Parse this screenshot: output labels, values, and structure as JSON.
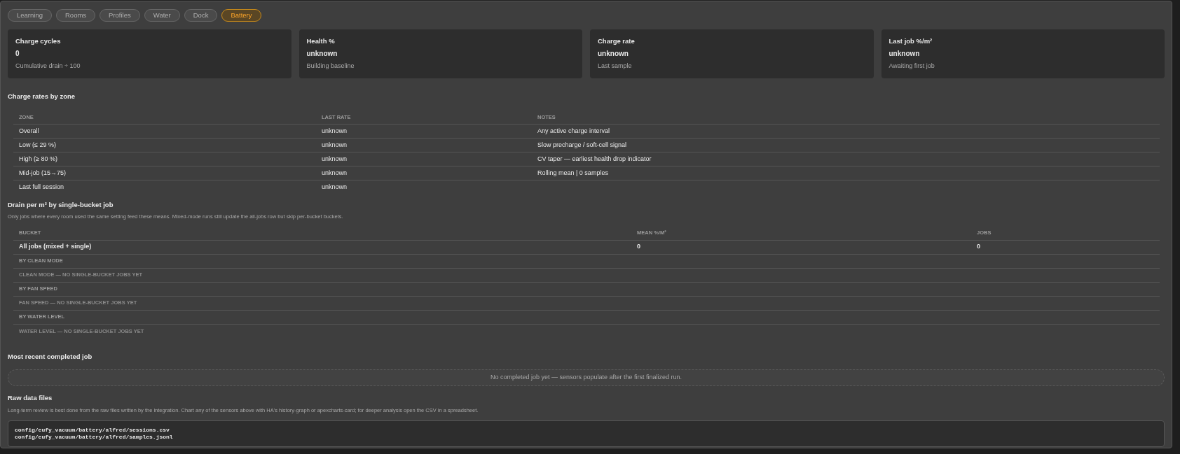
{
  "tabs": [
    {
      "label": "Learning",
      "selected": false
    },
    {
      "label": "Rooms",
      "selected": false
    },
    {
      "label": "Profiles",
      "selected": false
    },
    {
      "label": "Water",
      "selected": false
    },
    {
      "label": "Dock",
      "selected": false
    },
    {
      "label": "Battery",
      "selected": true
    }
  ],
  "stats": [
    {
      "title": "Charge cycles",
      "value": "0",
      "caption": "Cumulative drain ÷ 100"
    },
    {
      "title": "Health %",
      "value": "unknown",
      "caption": "Building baseline"
    },
    {
      "title": "Charge rate",
      "value": "unknown",
      "caption": "Last sample"
    },
    {
      "title": "Last job %/m²",
      "value": "unknown",
      "caption": "Awaiting first job"
    }
  ],
  "zone_table": {
    "title": "Charge rates by zone",
    "columns": [
      "ZONE",
      "LAST RATE",
      "NOTES"
    ],
    "rows": [
      [
        "Overall",
        "unknown",
        "Any active charge interval"
      ],
      [
        "Low (≤ 29 %)",
        "unknown",
        "Slow precharge / soft-cell signal"
      ],
      [
        "High (≥ 80 %)",
        "unknown",
        "CV taper — earliest health drop indicator"
      ],
      [
        "Mid-job (15→75)",
        "unknown",
        "Rolling mean | 0 samples"
      ],
      [
        "Last full session",
        "unknown"
      ]
    ]
  },
  "drain_table": {
    "title": "Drain per m² by single-bucket job",
    "description": "Only jobs where every room used the same setting feed these means. Mixed-mode runs still update the all-jobs row but skip per-bucket buckets.",
    "columns": [
      "BUCKET",
      "MEAN %/M²",
      "JOBS"
    ],
    "rows": [
      {
        "kind": "data",
        "cells": [
          "All jobs (mixed + single)",
          "0",
          "0"
        ]
      },
      {
        "kind": "group",
        "cells": [
          "BY CLEAN MODE"
        ]
      },
      {
        "kind": "empty",
        "cells": [
          "CLEAN MODE — NO SINGLE-BUCKET JOBS YET"
        ]
      },
      {
        "kind": "group",
        "cells": [
          "BY FAN SPEED"
        ]
      },
      {
        "kind": "empty",
        "cells": [
          "FAN SPEED — NO SINGLE-BUCKET JOBS YET"
        ]
      },
      {
        "kind": "group",
        "cells": [
          "BY WATER LEVEL"
        ]
      },
      {
        "kind": "empty",
        "cells": [
          "WATER LEVEL — NO SINGLE-BUCKET JOBS YET"
        ]
      }
    ]
  },
  "recent_job": {
    "title": "Most recent completed job",
    "empty_message": "No completed job yet — sensors populate after the first finalized run."
  },
  "raw_files": {
    "title": "Raw data files",
    "description": "Long-term review is best done from the raw files written by the integration. Chart any of the sensors above with HA's history-graph or apexcharts-card; for deeper analysis open the CSV in a spreadsheet.",
    "paths": [
      "config/eufy_vacuum/battery/alfred/sessions.csv",
      "config/eufy_vacuum/battery/alfred/samples.jsonl"
    ]
  }
}
